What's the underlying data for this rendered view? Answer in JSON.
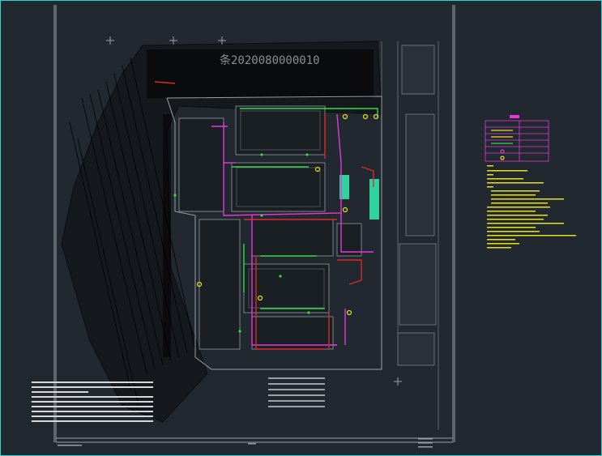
{
  "drawing": {
    "plan_title": "条2020080000010"
  },
  "colors": {
    "background": "#212830",
    "frame": "#2fd3d3",
    "gas_main": "#e23ad8",
    "fire_pipe": "#d92b2b",
    "water_pipe": "#38d84a",
    "note_text": "#e8e020",
    "building": "#7c828a",
    "terrain": "#111417"
  },
  "icons": [
    "valve-icon",
    "hydrant-icon",
    "fire-hydrant-icon"
  ]
}
